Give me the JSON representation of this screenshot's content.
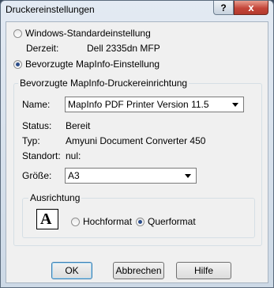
{
  "window": {
    "title": "Druckereinstellungen",
    "help_glyph": "?",
    "close_glyph": "x"
  },
  "printer_choice": {
    "windows_default_label": "Windows-Standardeinstellung",
    "current_label": "Derzeit:",
    "current_value": "Dell 2335dn MFP",
    "mapinfo_preferred_label": "Bevorzugte MapInfo-Einstellung",
    "selected": "mapinfo"
  },
  "preferred_group": {
    "legend": "Bevorzugte MapInfo-Druckereinrichtung",
    "name_label": "Name:",
    "name_value": "MapInfo PDF Printer Version 11.5",
    "status_label": "Status:",
    "status_value": "Bereit",
    "type_label": "Typ:",
    "type_value": "Amyuni Document Converter 450",
    "location_label": "Standort:",
    "location_value": "nul:",
    "size_label": "Größe:",
    "size_value": "A3"
  },
  "orientation": {
    "legend": "Ausrichtung",
    "icon_letter": "A",
    "portrait_label": "Hochformat",
    "landscape_label": "Querformat",
    "selected": "landscape"
  },
  "buttons": {
    "ok": "OK",
    "cancel": "Abbrechen",
    "help": "Hilfe"
  }
}
